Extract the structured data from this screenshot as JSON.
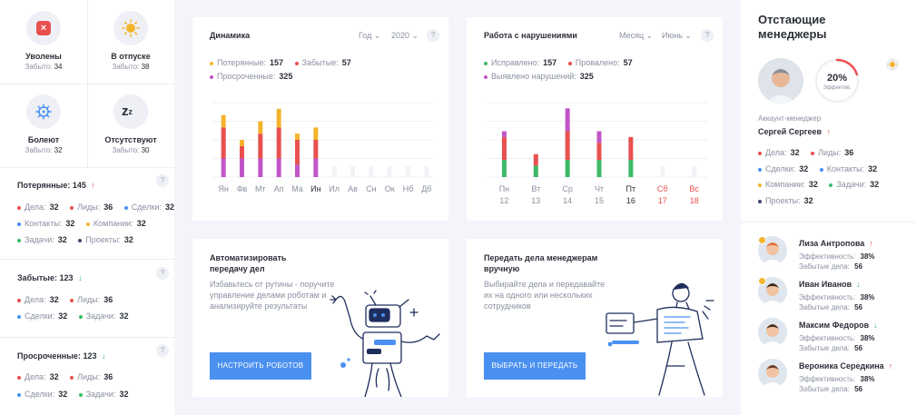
{
  "status_tiles": [
    {
      "title": "Уволены",
      "sub_label": "Забыто:",
      "sub_value": "34",
      "icon": "close-icon",
      "color": "#e8504f"
    },
    {
      "title": "В отпуске",
      "sub_label": "Забыто:",
      "sub_value": "38",
      "icon": "sun-icon",
      "color": "#f4b52c"
    },
    {
      "title": "Болеют",
      "sub_label": "Забыто:",
      "sub_value": "32",
      "icon": "virus-icon",
      "color": "#4a90f0"
    },
    {
      "title": "Отсутствуют",
      "sub_label": "Забыто:",
      "sub_value": "30",
      "icon": "sleep-icon",
      "color": "#2b2f38"
    }
  ],
  "sections": [
    {
      "title": "Потерянные:",
      "count": "145",
      "trend": "up",
      "lines": [
        [
          {
            "k": "Дела:",
            "v": "32",
            "c": "#e8504f"
          },
          {
            "k": "Лиды:",
            "v": "36",
            "c": "#e8504f"
          },
          {
            "k": "Сделки:",
            "v": "32",
            "c": "#4a90f0"
          }
        ],
        [
          {
            "k": "Контакты:",
            "v": "32",
            "c": "#4a90f0"
          },
          {
            "k": "Компании:",
            "v": "32",
            "c": "#f4b52c"
          }
        ],
        [
          {
            "k": "Задачи:",
            "v": "32",
            "c": "#3cb965"
          },
          {
            "k": "Проекты:",
            "v": "32",
            "c": "#3c4a6b"
          }
        ]
      ]
    },
    {
      "title": "Забытые:",
      "count": "123",
      "trend": "down",
      "lines": [
        [
          {
            "k": "Дела:",
            "v": "32",
            "c": "#e8504f"
          },
          {
            "k": "Лиды:",
            "v": "36",
            "c": "#e8504f"
          }
        ],
        [
          {
            "k": "Сделки:",
            "v": "32",
            "c": "#4a90f0"
          },
          {
            "k": "Задачи:",
            "v": "32",
            "c": "#3cb965"
          }
        ]
      ]
    },
    {
      "title": "Просроченные:",
      "count": "123",
      "trend": "down",
      "lines": [
        [
          {
            "k": "Дела:",
            "v": "32",
            "c": "#e8504f"
          },
          {
            "k": "Лиды:",
            "v": "36",
            "c": "#e8504f"
          }
        ],
        [
          {
            "k": "Сделки:",
            "v": "32",
            "c": "#4a90f0"
          },
          {
            "k": "Задачи:",
            "v": "32",
            "c": "#3cb965"
          }
        ]
      ]
    }
  ],
  "dynamics": {
    "title": "Динамика",
    "filter_year_label": "Год",
    "filter_year_value": "2020",
    "legend": [
      {
        "k": "Потерянные:",
        "v": "157",
        "c": "#f4b52c"
      },
      {
        "k": "Забытые:",
        "v": "57",
        "c": "#e8504f"
      },
      {
        "k": "Просроченные:",
        "v": "325",
        "c": "#c055c8"
      }
    ]
  },
  "violations": {
    "title": "Работа с нарушениями",
    "filter_period": "Месяц",
    "filter_month": "Июнь",
    "legend": [
      {
        "k": "Исправлено:",
        "v": "157",
        "c": "#3cb965"
      },
      {
        "k": "Провалено:",
        "v": "57",
        "c": "#e8504f"
      },
      {
        "k": "Выявлено нарушений:",
        "v": "325",
        "c": "#c055c8"
      }
    ]
  },
  "chart_data": [
    {
      "type": "bar",
      "categories": [
        "Ян",
        "Фв",
        "Мт",
        "Ап",
        "Ма",
        "Ин",
        "Ил",
        "Ав",
        "Сн",
        "Ок",
        "Нб",
        "Дб"
      ],
      "series": [
        {
          "name": "Просроченные",
          "values": [
            3,
            3,
            3,
            3,
            2,
            3,
            0,
            0,
            0,
            0,
            0,
            0
          ],
          "color": "#c055c8"
        },
        {
          "name": "Забытые",
          "values": [
            5,
            2,
            4,
            5,
            4,
            3,
            0,
            0,
            0,
            0,
            0,
            0
          ],
          "color": "#e8504f"
        },
        {
          "name": "Потерянные",
          "values": [
            2,
            1,
            2,
            3,
            1,
            2,
            0,
            0,
            0,
            0,
            0,
            0
          ],
          "color": "#f4b52c"
        }
      ],
      "active_category": "Ин",
      "ylim": [
        0,
        12
      ]
    },
    {
      "type": "bar",
      "categories": [
        "Пн 12",
        "Вт 13",
        "Ср 14",
        "Чт 15",
        "Пт 16",
        "Сб 17",
        "Вс 18"
      ],
      "category_top": [
        "Пн",
        "Вт",
        "Ср",
        "Чт",
        "Пт",
        "Сб",
        "Вс"
      ],
      "category_bottom": [
        "12",
        "13",
        "14",
        "15",
        "16",
        "17",
        "18"
      ],
      "series": [
        {
          "name": "Исправлено",
          "values": [
            3,
            2,
            3,
            3,
            3,
            0,
            0
          ],
          "color": "#3cb965"
        },
        {
          "name": "Провалено",
          "values": [
            4,
            2,
            5,
            3,
            4,
            0,
            0
          ],
          "color": "#e8504f"
        },
        {
          "name": "Выявлено нарушений",
          "values": [
            1,
            0,
            4,
            2,
            0,
            0,
            0
          ],
          "color": "#c055c8"
        }
      ],
      "active_category": "Пт 16",
      "weekend": [
        "Сб 17",
        "Вс 18"
      ],
      "ylim": [
        0,
        13
      ]
    }
  ],
  "promo_robots": {
    "title": "Автоматизировать передачу дел",
    "desc": "Избавьтесь от рутины - поручите управление делами роботам и анализируйте результаты",
    "button": "НАСТРОИТЬ РОБОТОВ"
  },
  "promo_transfer": {
    "title": "Передать дела менеджерам вручную",
    "desc": "Выбирайте дела и передавайте их на одного или нескольких сотрудников",
    "button": "ВЫБРАТЬ И ПЕРЕДАТЬ"
  },
  "lagging": {
    "title": "Отстающие менеджеры",
    "efficiency_percent": 20,
    "efficiency_value": "20%",
    "efficiency_label": "Эффектив.",
    "role": "Аккаунт-менеджер",
    "name": "Сергей Сергеев",
    "stats": [
      [
        {
          "k": "Дела:",
          "v": "32",
          "c": "#e8504f"
        },
        {
          "k": "Лиды:",
          "v": "36",
          "c": "#e8504f"
        }
      ],
      [
        {
          "k": "Сделки:",
          "v": "32",
          "c": "#4a90f0"
        },
        {
          "k": "Контакты:",
          "v": "32",
          "c": "#4a90f0"
        }
      ],
      [
        {
          "k": "Компании:",
          "v": "32",
          "c": "#f4b52c"
        },
        {
          "k": "Задачи:",
          "v": "32",
          "c": "#3cb965"
        }
      ],
      [
        {
          "k": "Проекты:",
          "v": "32",
          "c": "#3c4a6b"
        }
      ]
    ]
  },
  "managers": [
    {
      "name": "Лиза Антропова",
      "trend": "up",
      "eff_label": "Эффективность:",
      "eff": "38%",
      "forgot_label": "Забытые дела:",
      "forgot": "56",
      "hair": "#e2733a",
      "badge": true
    },
    {
      "name": "Иван Иванов",
      "trend": "down",
      "eff_label": "Эффективность:",
      "eff": "38%",
      "forgot_label": "Забытые дела:",
      "forgot": "56",
      "hair": "#3a2a22",
      "badge": true
    },
    {
      "name": "Максим Федоров",
      "trend": "down",
      "eff_label": "Эффективность:",
      "eff": "38%",
      "forgot_label": "Забытые дела:",
      "forgot": "56",
      "hair": "#4a3124",
      "badge": false
    },
    {
      "name": "Вероника Середкина",
      "trend": "up",
      "eff_label": "Эффективность:",
      "eff": "38%",
      "forgot_label": "Забытые дела:",
      "forgot": "56",
      "hair": "#6b3f2a",
      "badge": false
    }
  ],
  "colors": {
    "up": "#e8504f",
    "down": "#3cb965",
    "accent": "#4a90f0"
  }
}
